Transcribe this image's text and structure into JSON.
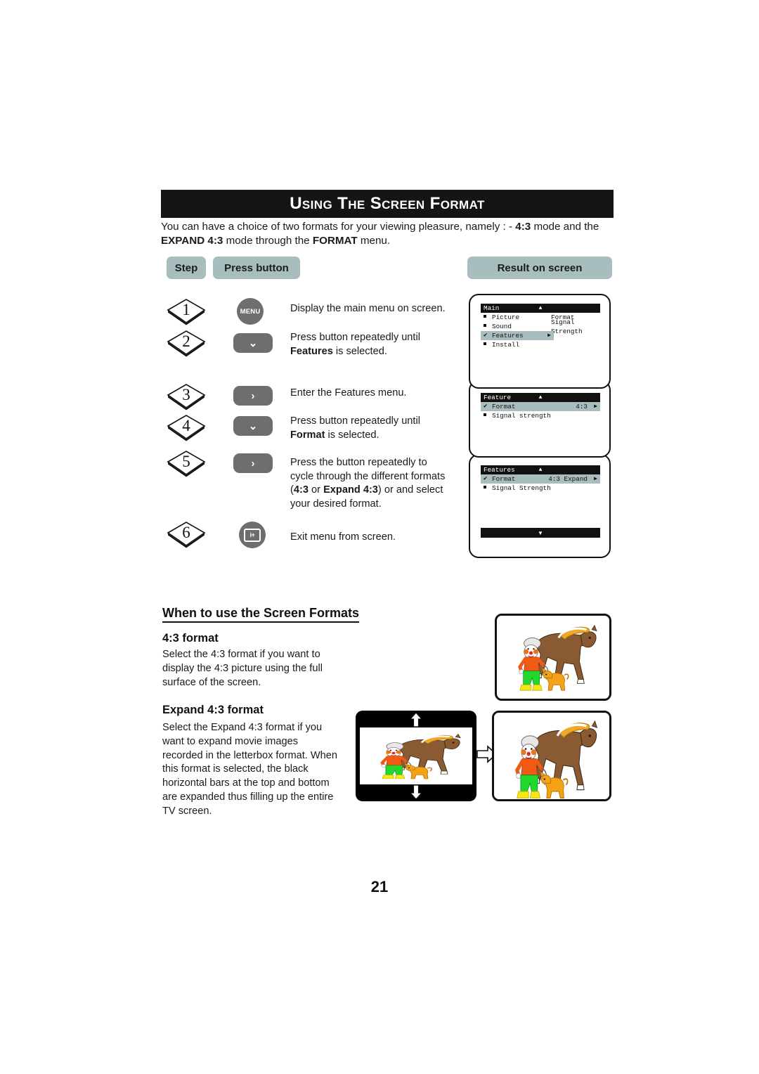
{
  "page": {
    "number": "21",
    "title": "Using the Screen Format"
  },
  "intro": {
    "part1": "You can have a choice of two formats for your viewing pleasure, namely : - ",
    "b1": "4:3",
    "part2": " mode and the ",
    "b2": "EXPAND 4:3",
    "part3": " mode through the ",
    "b3": "FORMAT",
    "part4": " menu."
  },
  "table_headers": {
    "step": "Step",
    "press_button": "Press button",
    "result_on_screen": "Result on screen"
  },
  "steps": [
    {
      "number": "1",
      "button_kind": "round-label",
      "button_label": "MENU",
      "icon": "menu-button-icon",
      "text_plain": "Display the main menu on screen.",
      "text_line1": "Display the main menu on screen.",
      "text_line2_pre": "",
      "text_line2_bold": "",
      "text_line2_post": ""
    },
    {
      "number": "2",
      "button_kind": "pill-chevron",
      "button_label": "⌄",
      "icon": "chevron-down-icon",
      "text_line1": "Press button repeatedly until",
      "text_line2_bold": "Features",
      "text_line2_post": " is selected."
    },
    {
      "number": "3",
      "button_kind": "pill-chevron",
      "button_label": "›",
      "icon": "chevron-right-icon",
      "text_line1": "Enter the Features menu.",
      "text_line2_bold": "",
      "text_line2_post": ""
    },
    {
      "number": "4",
      "button_kind": "pill-chevron",
      "button_label": "⌄",
      "icon": "chevron-down-icon",
      "text_line1": "Press button repeatedly until",
      "text_line2_bold": "Format",
      "text_line2_post": " is selected."
    },
    {
      "number": "5",
      "button_kind": "pill-chevron",
      "button_label": "›",
      "icon": "chevron-right-icon",
      "text_line1": "Press the button repeatedly to",
      "text_line2": "cycle through the different formats",
      "text_line3_open": "(",
      "text_line3_b1": "4:3",
      "text_line3_mid": " or ",
      "text_line3_b2": "Expand 4:3",
      "text_line3_close": ") or and select",
      "text_line4": "your desired format."
    },
    {
      "number": "6",
      "button_kind": "round-icon",
      "button_label": "i+",
      "icon": "status-display-icon",
      "text_line1": "Exit menu from screen.",
      "text_line2_bold": "",
      "text_line2_post": ""
    }
  ],
  "osd_screens": [
    {
      "name": "main-menu",
      "title": "Main",
      "up_arrow": "▲",
      "rows": [
        {
          "mark": "square",
          "label": "Picture",
          "col2": "Format",
          "value": "",
          "caret": "",
          "selected": false
        },
        {
          "mark": "square",
          "label": "Sound",
          "col2": "Signal Strength",
          "value": "",
          "caret": "",
          "selected": false
        },
        {
          "mark": "check",
          "label": "Features",
          "col2": "",
          "value": "",
          "caret": "▶",
          "selected": true
        },
        {
          "mark": "square",
          "label": "Install",
          "col2": "",
          "value": "",
          "caret": "",
          "selected": false
        }
      ],
      "footer": ""
    },
    {
      "name": "feature-menu",
      "title": "Feature",
      "up_arrow": "▲",
      "rows": [
        {
          "mark": "check",
          "label": "Format",
          "col2": "",
          "value": "4:3",
          "caret": "▶",
          "selected": true
        },
        {
          "mark": "square",
          "label": "Signal strength",
          "col2": "",
          "value": "",
          "caret": "",
          "selected": false
        }
      ],
      "footer": ""
    },
    {
      "name": "features-menu-expand",
      "title": "Features",
      "up_arrow": "▲",
      "rows": [
        {
          "mark": "check",
          "label": "Format",
          "col2": "",
          "value": "4:3 Expand",
          "caret": "▶",
          "selected": true
        },
        {
          "mark": "square",
          "label": "Signal Strength",
          "col2": "",
          "value": "",
          "caret": "",
          "selected": false
        }
      ],
      "footer": "▼"
    }
  ],
  "sections": {
    "when_heading": "When to use the Screen Formats",
    "format43": {
      "heading": "4:3 format",
      "body": "Select the 4:3 format if you want to display the 4:3 picture using the full surface of the screen."
    },
    "expand43": {
      "heading": "Expand 4:3 format",
      "body": "Select the Expand 4:3 format if you want to expand movie images recorded in the letterbox format. When this format is selected, the black horizontal bars at the top and bottom are expanded thus filling up the entire TV screen."
    }
  },
  "illustrations": {
    "image_43": "clown-horse-dog-4-3-screen",
    "image_letterbox": "clown-horse-dog-letterbox-screen",
    "image_expanded": "clown-horse-dog-expanded-screen",
    "transform_arrow": "right-arrow-icon",
    "expand_up_arrow": "up-arrow-icon",
    "expand_down_arrow": "down-arrow-icon"
  },
  "colors": {
    "title_bar": "#151515",
    "pill_bg": "#a8bdbd",
    "button_gray": "#6e6e6e",
    "osd_title_bg": "#111111",
    "osd_highlight": "#a8bdbd"
  }
}
